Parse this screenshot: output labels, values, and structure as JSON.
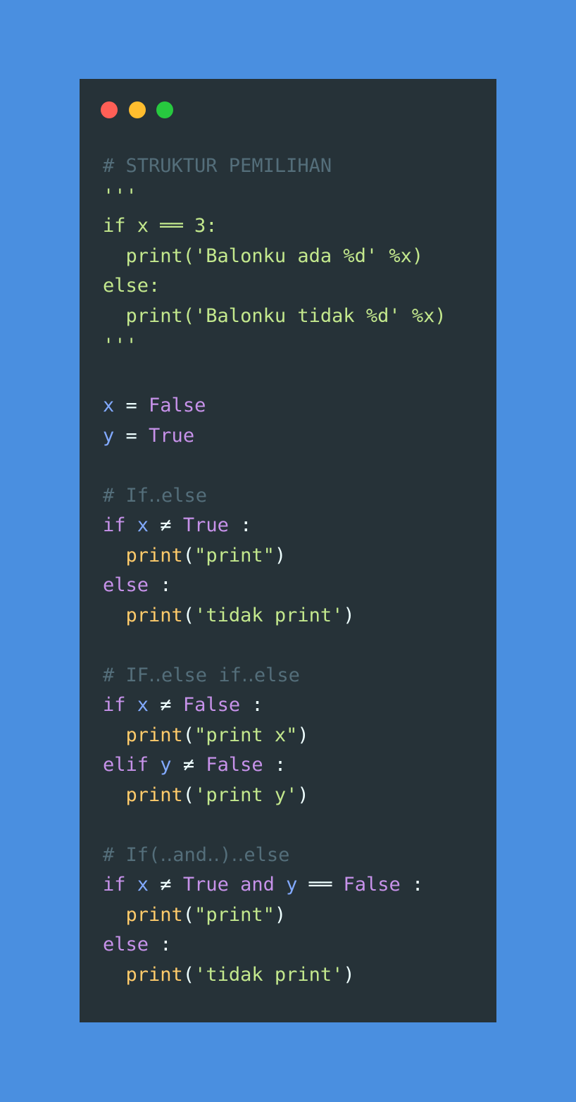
{
  "colors": {
    "background": "#4a8fe0",
    "editor": "#263238",
    "comment": "#546e7a",
    "string": "#c3e88d",
    "keyword": "#c792ea",
    "variable": "#82aaff",
    "function": "#ffcb6b",
    "text": "#eeffff"
  },
  "window_controls": [
    "close-icon",
    "minimize-icon",
    "maximize-icon"
  ],
  "code_lines": [
    [
      {
        "t": "# STRUKTUR PEMILIHAN",
        "c": "com"
      }
    ],
    [
      {
        "t": "'''",
        "c": "str"
      }
    ],
    [
      {
        "t": "if x ══ 3:",
        "c": "str"
      }
    ],
    [
      {
        "t": "  print('Balonku ada %d' %x)",
        "c": "str"
      }
    ],
    [
      {
        "t": "else:",
        "c": "str"
      }
    ],
    [
      {
        "t": "  print('Balonku tidak %d' %x)",
        "c": "str"
      }
    ],
    [
      {
        "t": "'''",
        "c": "str"
      }
    ],
    [],
    [
      {
        "t": "x",
        "c": "var"
      },
      {
        "t": " = ",
        "c": "op"
      },
      {
        "t": "False",
        "c": "kw"
      }
    ],
    [
      {
        "t": "y",
        "c": "var"
      },
      {
        "t": " = ",
        "c": "op"
      },
      {
        "t": "True",
        "c": "kw"
      }
    ],
    [],
    [
      {
        "t": "# If‥else",
        "c": "com"
      }
    ],
    [
      {
        "t": "if",
        "c": "kw"
      },
      {
        "t": " ",
        "c": "txt"
      },
      {
        "t": "x",
        "c": "var"
      },
      {
        "t": " ≠ ",
        "c": "op"
      },
      {
        "t": "True",
        "c": "kw"
      },
      {
        "t": " :",
        "c": "op"
      }
    ],
    [
      {
        "t": "  ",
        "c": "txt"
      },
      {
        "t": "print",
        "c": "fn"
      },
      {
        "t": "(",
        "c": "txt"
      },
      {
        "t": "\"print\"",
        "c": "str"
      },
      {
        "t": ")",
        "c": "txt"
      }
    ],
    [
      {
        "t": "else",
        "c": "kw"
      },
      {
        "t": " :",
        "c": "op"
      }
    ],
    [
      {
        "t": "  ",
        "c": "txt"
      },
      {
        "t": "print",
        "c": "fn"
      },
      {
        "t": "(",
        "c": "txt"
      },
      {
        "t": "'tidak print'",
        "c": "str"
      },
      {
        "t": ")",
        "c": "txt"
      }
    ],
    [],
    [
      {
        "t": "# IF‥else if‥else",
        "c": "com"
      }
    ],
    [
      {
        "t": "if",
        "c": "kw"
      },
      {
        "t": " ",
        "c": "txt"
      },
      {
        "t": "x",
        "c": "var"
      },
      {
        "t": " ≠ ",
        "c": "op"
      },
      {
        "t": "False",
        "c": "kw"
      },
      {
        "t": " :",
        "c": "op"
      }
    ],
    [
      {
        "t": "  ",
        "c": "txt"
      },
      {
        "t": "print",
        "c": "fn"
      },
      {
        "t": "(",
        "c": "txt"
      },
      {
        "t": "\"print x\"",
        "c": "str"
      },
      {
        "t": ")",
        "c": "txt"
      }
    ],
    [
      {
        "t": "elif",
        "c": "kw"
      },
      {
        "t": " ",
        "c": "txt"
      },
      {
        "t": "y",
        "c": "var"
      },
      {
        "t": " ≠ ",
        "c": "op"
      },
      {
        "t": "False",
        "c": "kw"
      },
      {
        "t": " :",
        "c": "op"
      }
    ],
    [
      {
        "t": "  ",
        "c": "txt"
      },
      {
        "t": "print",
        "c": "fn"
      },
      {
        "t": "(",
        "c": "txt"
      },
      {
        "t": "'print y'",
        "c": "str"
      },
      {
        "t": ")",
        "c": "txt"
      }
    ],
    [],
    [
      {
        "t": "# If(‥and‥)‥else",
        "c": "com"
      }
    ],
    [
      {
        "t": "if",
        "c": "kw"
      },
      {
        "t": " ",
        "c": "txt"
      },
      {
        "t": "x",
        "c": "var"
      },
      {
        "t": " ≠ ",
        "c": "op"
      },
      {
        "t": "True",
        "c": "kw"
      },
      {
        "t": " ",
        "c": "txt"
      },
      {
        "t": "and",
        "c": "kw"
      },
      {
        "t": " ",
        "c": "txt"
      },
      {
        "t": "y",
        "c": "var"
      },
      {
        "t": " ══ ",
        "c": "op"
      },
      {
        "t": "False",
        "c": "kw"
      },
      {
        "t": " :",
        "c": "op"
      }
    ],
    [
      {
        "t": "  ",
        "c": "txt"
      },
      {
        "t": "print",
        "c": "fn"
      },
      {
        "t": "(",
        "c": "txt"
      },
      {
        "t": "\"print\"",
        "c": "str"
      },
      {
        "t": ")",
        "c": "txt"
      }
    ],
    [
      {
        "t": "else",
        "c": "kw"
      },
      {
        "t": " :",
        "c": "op"
      }
    ],
    [
      {
        "t": "  ",
        "c": "txt"
      },
      {
        "t": "print",
        "c": "fn"
      },
      {
        "t": "(",
        "c": "txt"
      },
      {
        "t": "'tidak print'",
        "c": "str"
      },
      {
        "t": ")",
        "c": "txt"
      }
    ]
  ]
}
